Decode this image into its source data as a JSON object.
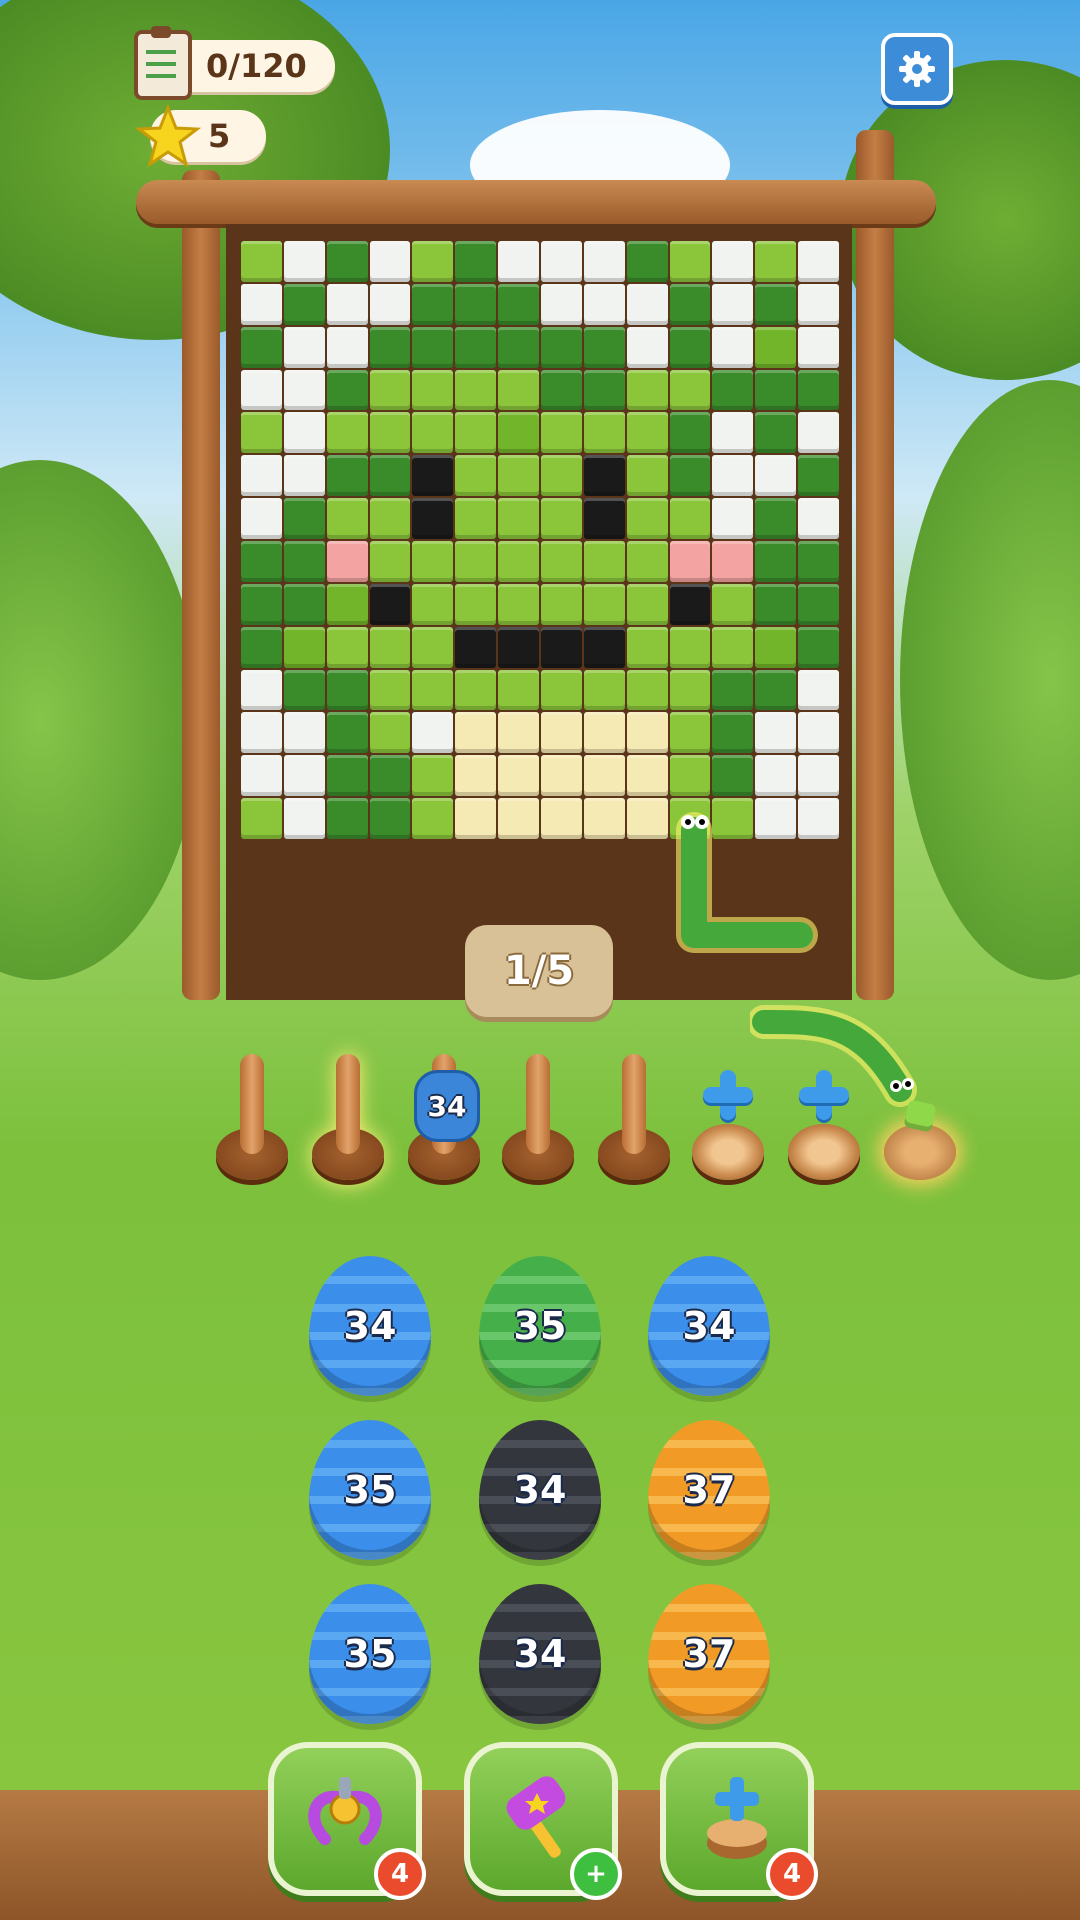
{
  "hud": {
    "progress": "0/120",
    "stars": "5",
    "clipboard_icon": "clipboard-icon",
    "star_icon": "star-icon",
    "settings_icon": "gear-icon"
  },
  "level": {
    "label": "1/5"
  },
  "grid_colors": {
    "0": "#f1f3f0",
    "1": "#8bc63a",
    "2": "#3a8c2b",
    "3": "#73b52a",
    "4": "#1a1a1a",
    "5": "#f3a4a2",
    "6": "#f6eab4"
  },
  "pixel_art": [
    "10201200021010",
    "02002220002020",
    "20022222202030",
    "00211112211222",
    "10111131112020",
    "00224111412002",
    "02114111411020",
    "22511111115522",
    "22341111114122",
    "23111444411132",
    "02211111111220",
    "00210666661200",
    "00221666661200",
    "10221666661100"
  ],
  "slots": [
    {
      "type": "peg"
    },
    {
      "type": "peg",
      "selected": true
    },
    {
      "type": "peg",
      "occupant": "blue-snake",
      "count": "34"
    },
    {
      "type": "peg"
    },
    {
      "type": "peg"
    },
    {
      "type": "add"
    },
    {
      "type": "add"
    },
    {
      "type": "nest"
    }
  ],
  "eggs": [
    {
      "value": "34",
      "color": "blue"
    },
    {
      "value": "35",
      "color": "green"
    },
    {
      "value": "34",
      "color": "blue"
    },
    {
      "value": "35",
      "color": "blue"
    },
    {
      "value": "34",
      "color": "black"
    },
    {
      "value": "37",
      "color": "orange"
    },
    {
      "value": "35",
      "color": "blue"
    },
    {
      "value": "34",
      "color": "black"
    },
    {
      "value": "37",
      "color": "orange"
    }
  ],
  "tools": [
    {
      "name": "claw-grabber",
      "icon": "claw-icon",
      "badge": "4"
    },
    {
      "name": "hammer",
      "icon": "hammer-icon",
      "badge": "+"
    },
    {
      "name": "add-slot",
      "icon": "plus-stump-icon",
      "badge": "4"
    }
  ]
}
